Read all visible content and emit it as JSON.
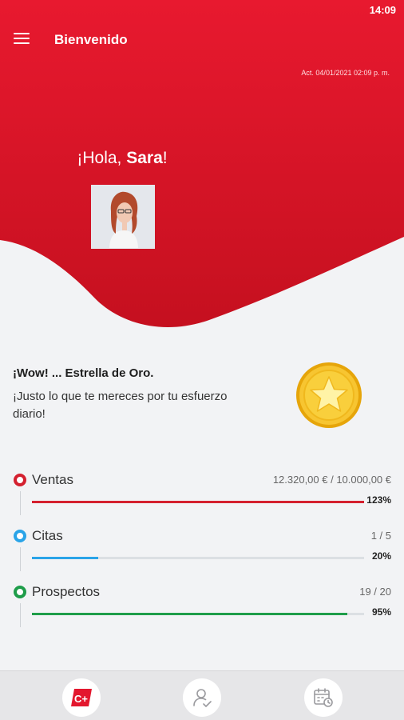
{
  "status_bar": {
    "time": "14:09"
  },
  "app_bar": {
    "title": "Bienvenido",
    "menu_icon": "menu-icon"
  },
  "header": {
    "last_update": "Act. 04/01/2021 02:09 p. m.",
    "greeting_prefix": "¡Hola, ",
    "user_name": "Sara",
    "greeting_suffix": "!",
    "avatar": "user-photo"
  },
  "award": {
    "title": "¡Wow! ... Estrella de Oro.",
    "message": "¡Justo lo que te mereces por tu esfuerzo diario!",
    "icon": "gold-star-medal-icon"
  },
  "metrics": [
    {
      "name": "Ventas",
      "value": "12.320,00 € / 10.000,00 €",
      "percent_label": "123%",
      "progress": 1.0,
      "color": "#d4202f"
    },
    {
      "name": "Citas",
      "value": "1 / 5",
      "percent_label": "20%",
      "progress": 0.2,
      "color": "#2aa4e8"
    },
    {
      "name": "Prospectos",
      "value": "19 / 20",
      "percent_label": "95%",
      "progress": 0.95,
      "color": "#1f9d4a"
    }
  ],
  "bottom_nav": [
    {
      "icon": "c-plus-logo-icon"
    },
    {
      "icon": "user-check-icon"
    },
    {
      "icon": "calendar-clock-icon"
    }
  ],
  "colors": {
    "brand_red": "#e3172e",
    "background": "#f2f3f5"
  }
}
